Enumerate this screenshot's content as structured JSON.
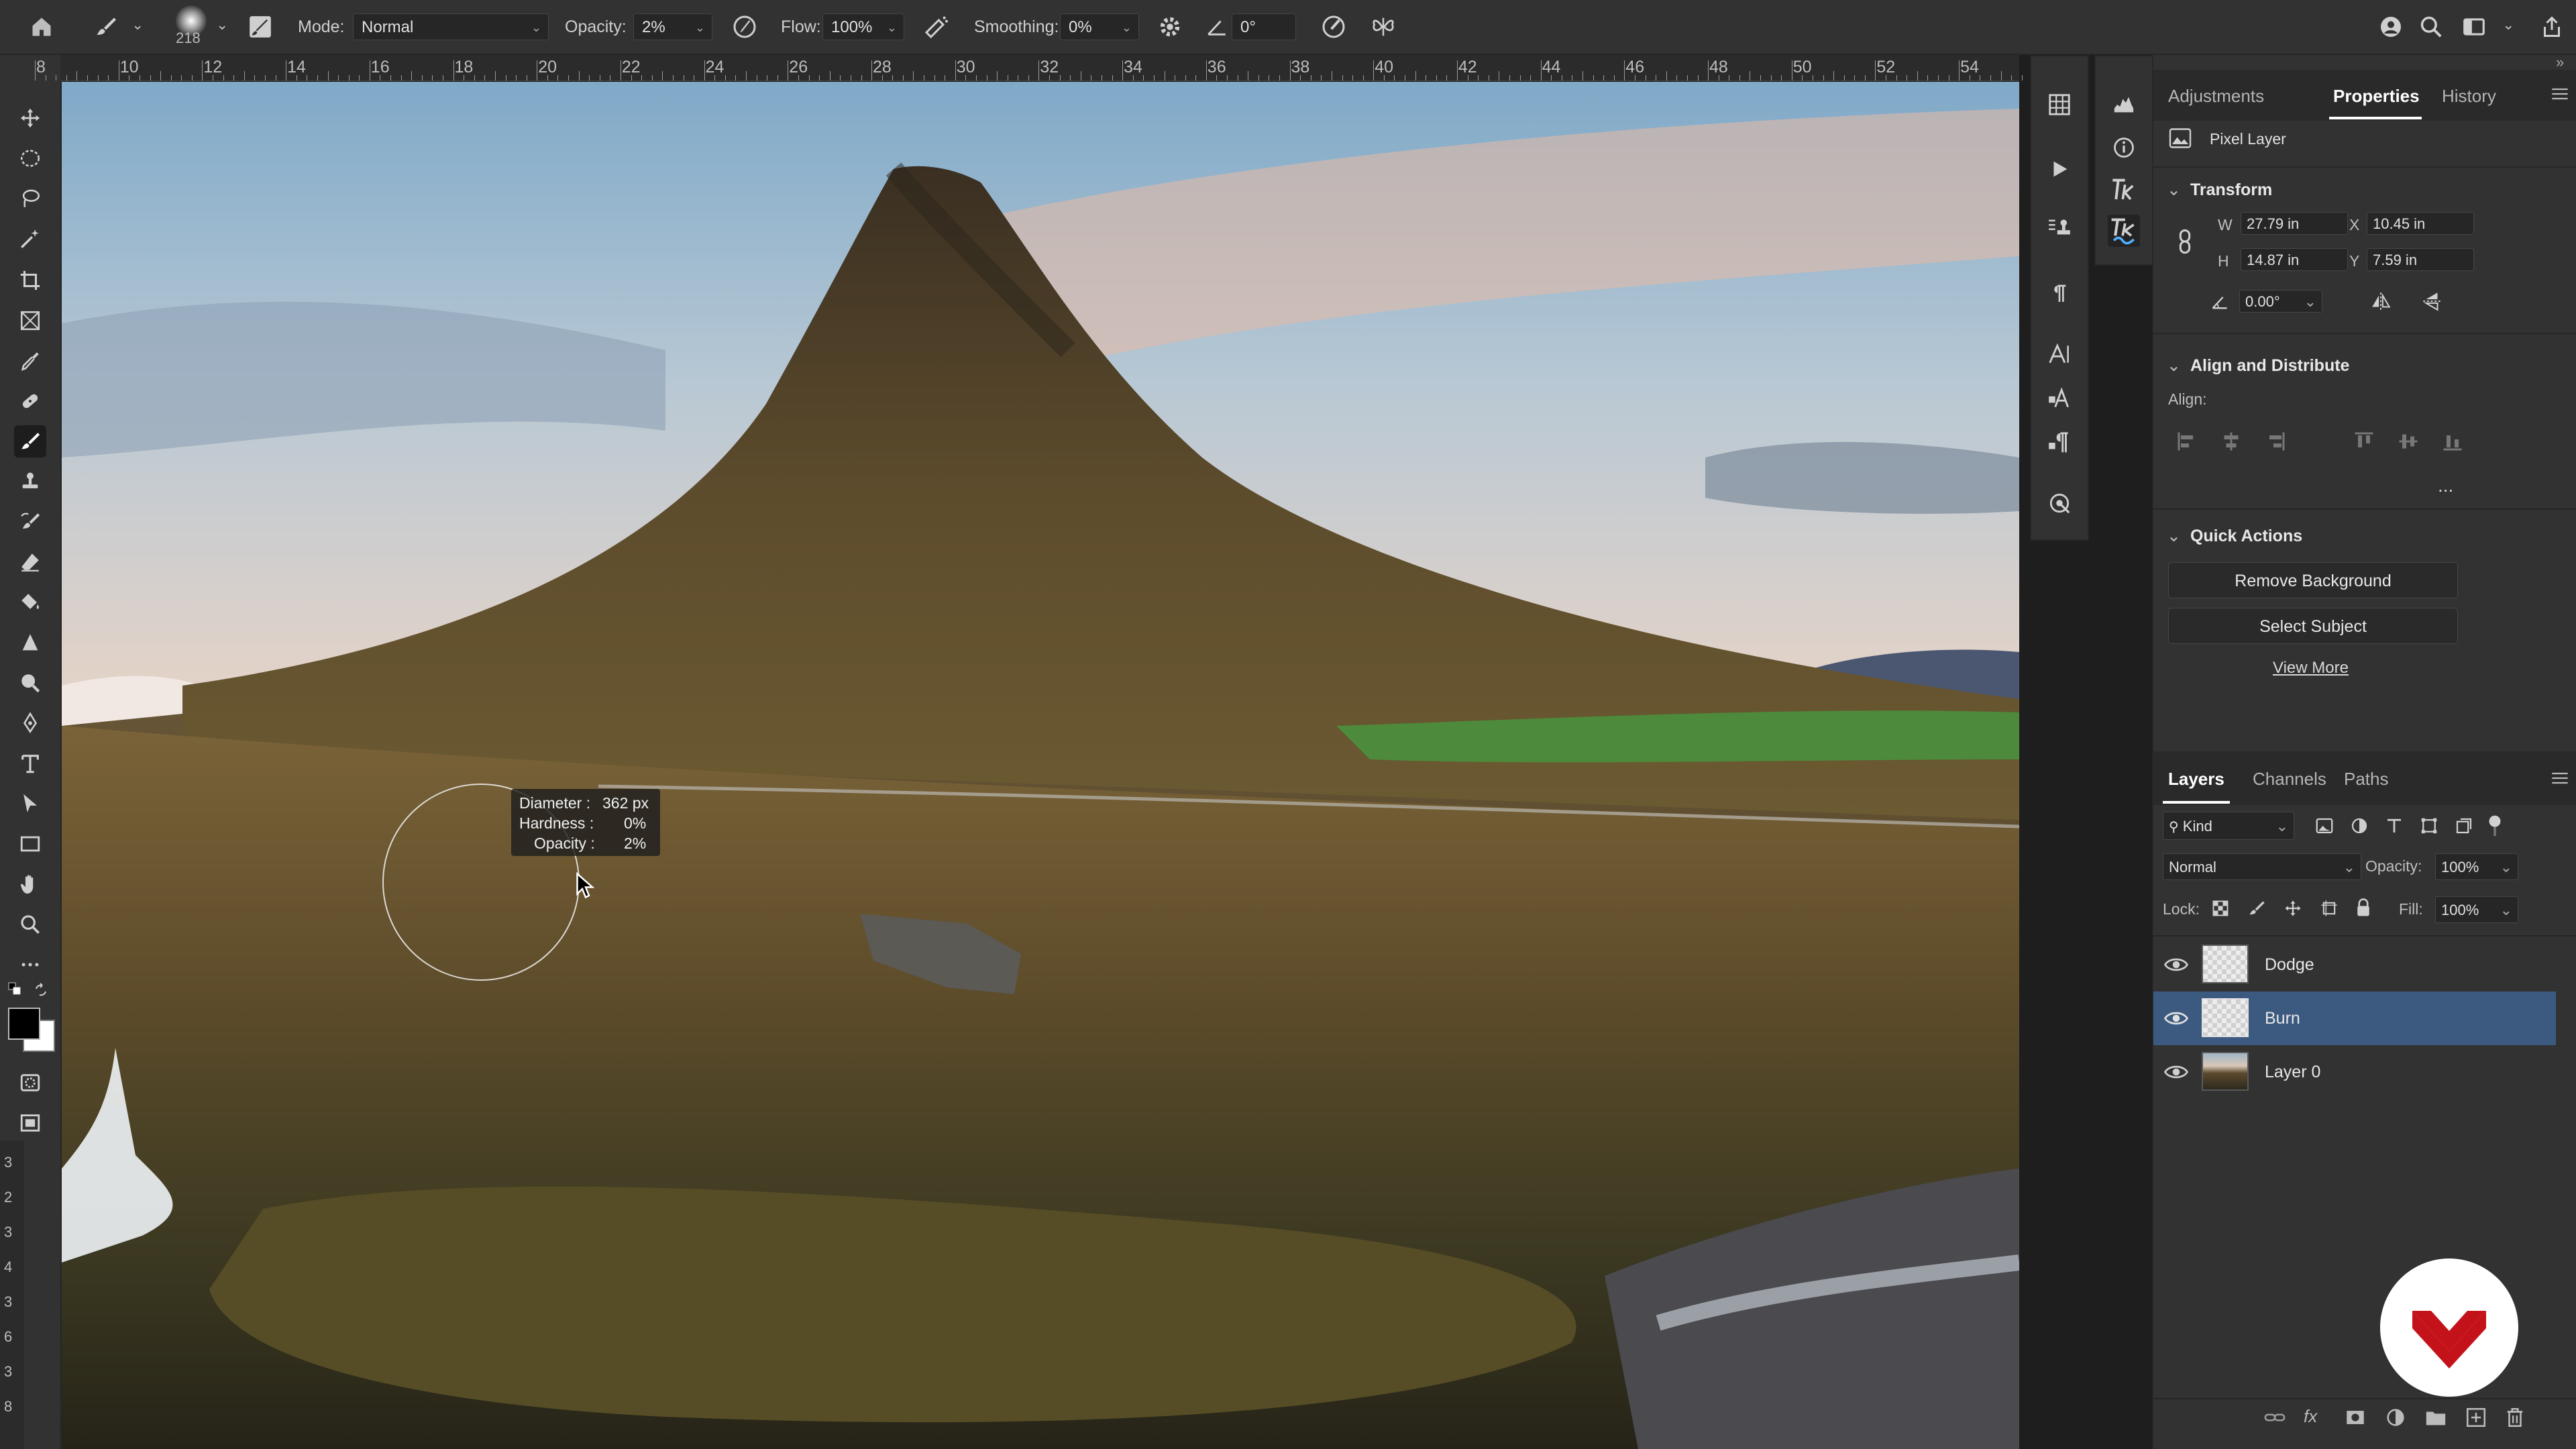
{
  "options_bar": {
    "brush_size": "218",
    "mode_label": "Mode:",
    "mode_value": "Normal",
    "opacity_label": "Opacity:",
    "opacity_value": "2%",
    "flow_label": "Flow:",
    "flow_value": "100%",
    "smoothing_label": "Smoothing:",
    "smoothing_value": "0%",
    "angle_value": "0°"
  },
  "ruler": {
    "top_ticks": [
      "8",
      "10",
      "12",
      "14",
      "16",
      "18",
      "20",
      "22",
      "24",
      "26",
      "28",
      "30",
      "32",
      "34",
      "36",
      "38",
      "40",
      "42",
      "44",
      "46",
      "48",
      "50",
      "52",
      "54"
    ],
    "left_ticks": [
      "3",
      "2",
      "3",
      "4",
      "3",
      "6",
      "3",
      "8"
    ]
  },
  "brush_tooltip": {
    "diameter_label": "Diameter :",
    "diameter_value": "362 px",
    "hardness_label": "Hardness :",
    "hardness_value": "0%",
    "opacity_label": "Opacity :",
    "opacity_value": "2%"
  },
  "properties_panel": {
    "tabs": [
      "Adjustments",
      "Properties",
      "History"
    ],
    "active_tab": "Properties",
    "layer_type": "Pixel Layer",
    "transform": {
      "title": "Transform",
      "w_label": "W",
      "w_value": "27.79 in",
      "x_label": "X",
      "x_value": "10.45 in",
      "h_label": "H",
      "h_value": "14.87 in",
      "y_label": "Y",
      "y_value": "7.59 in",
      "angle_value": "0.00°"
    },
    "align": {
      "title": "Align and Distribute",
      "align_label": "Align:",
      "more_label": "..."
    },
    "quick_actions": {
      "title": "Quick Actions",
      "remove_bg": "Remove Background",
      "select_subject": "Select Subject",
      "view_more": "View More"
    }
  },
  "layers_panel": {
    "tabs": [
      "Layers",
      "Channels",
      "Paths"
    ],
    "active_tab": "Layers",
    "kind_label": "Kind",
    "blend_mode": "Normal",
    "opacity_label": "Opacity:",
    "opacity_value": "100%",
    "lock_label": "Lock:",
    "fill_label": "Fill:",
    "fill_value": "100%",
    "layers": [
      {
        "name": "Dodge",
        "selected": false
      },
      {
        "name": "Burn",
        "selected": true
      },
      {
        "name": "Layer 0",
        "selected": false
      }
    ]
  },
  "colors": {
    "accent_selection": "#3c5a80",
    "brand_red": "#c4121a",
    "foreground_color": "#000000",
    "background_color": "#ffffff"
  },
  "icons": [
    "home-icon",
    "brush-icon",
    "brush-settings-icon",
    "airbrush-icon",
    "smoothing-gear-icon",
    "angle-icon",
    "pressure-icon",
    "symmetry-icon",
    "learn-icon",
    "search-icon",
    "workspace-icon",
    "share-icon"
  ]
}
